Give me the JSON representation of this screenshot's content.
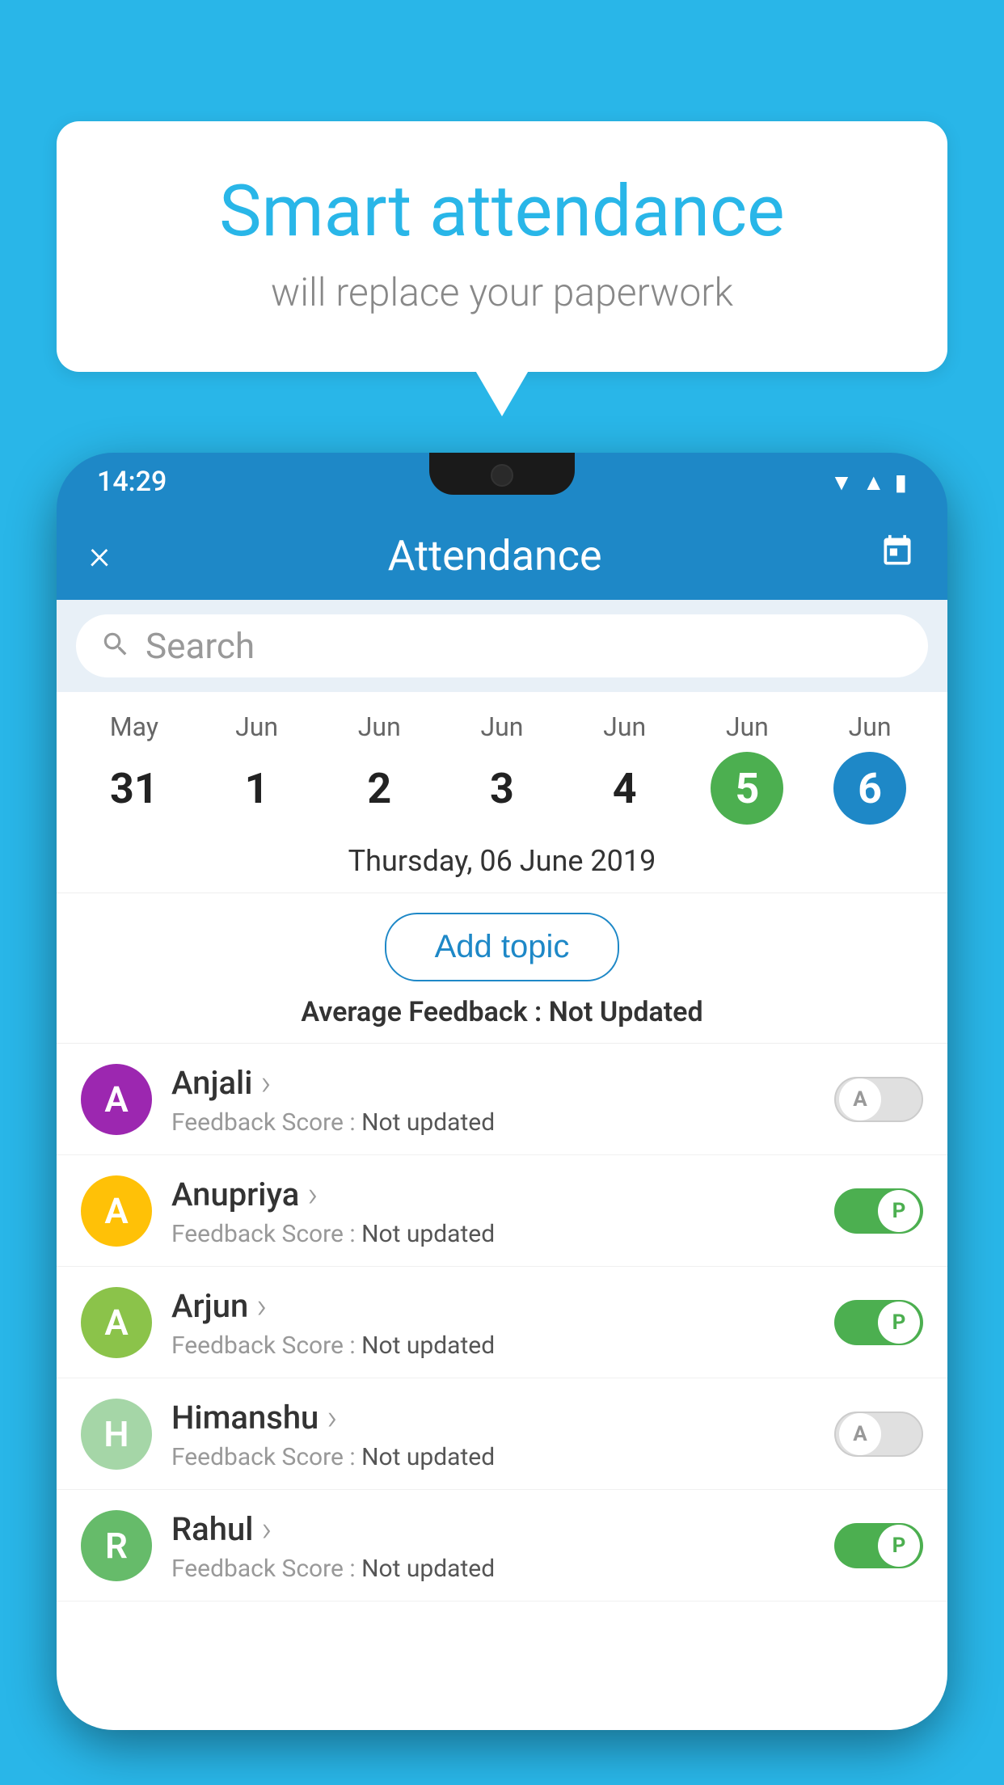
{
  "background": {
    "color": "#29b6e8"
  },
  "speech_bubble": {
    "title": "Smart attendance",
    "subtitle": "will replace your paperwork"
  },
  "status_bar": {
    "time": "14:29",
    "wifi": "▾",
    "signal": "▲",
    "battery": "▮"
  },
  "header": {
    "title": "Attendance",
    "close_label": "×",
    "calendar_icon": "📅"
  },
  "search": {
    "placeholder": "Search"
  },
  "calendar": {
    "days": [
      {
        "month": "May",
        "number": "31",
        "state": "normal"
      },
      {
        "month": "Jun",
        "number": "1",
        "state": "normal"
      },
      {
        "month": "Jun",
        "number": "2",
        "state": "normal"
      },
      {
        "month": "Jun",
        "number": "3",
        "state": "normal"
      },
      {
        "month": "Jun",
        "number": "4",
        "state": "normal"
      },
      {
        "month": "Jun",
        "number": "5",
        "state": "today"
      },
      {
        "month": "Jun",
        "number": "6",
        "state": "selected"
      }
    ]
  },
  "selected_date": "Thursday, 06 June 2019",
  "add_topic_label": "Add topic",
  "average_feedback": {
    "label": "Average Feedback : ",
    "value": "Not Updated"
  },
  "students": [
    {
      "name": "Anjali",
      "avatar_letter": "A",
      "avatar_color": "#9c27b0",
      "feedback_label": "Feedback Score : ",
      "feedback_value": "Not updated",
      "attendance": "absent"
    },
    {
      "name": "Anupriya",
      "avatar_letter": "A",
      "avatar_color": "#ffc107",
      "feedback_label": "Feedback Score : ",
      "feedback_value": "Not updated",
      "attendance": "present"
    },
    {
      "name": "Arjun",
      "avatar_letter": "A",
      "avatar_color": "#8bc34a",
      "feedback_label": "Feedback Score : ",
      "feedback_value": "Not updated",
      "attendance": "present"
    },
    {
      "name": "Himanshu",
      "avatar_letter": "H",
      "avatar_color": "#a5d6a7",
      "feedback_label": "Feedback Score : ",
      "feedback_value": "Not updated",
      "attendance": "absent"
    },
    {
      "name": "Rahul",
      "avatar_letter": "R",
      "avatar_color": "#66bb6a",
      "feedback_label": "Feedback Score : ",
      "feedback_value": "Not updated",
      "attendance": "present"
    }
  ]
}
